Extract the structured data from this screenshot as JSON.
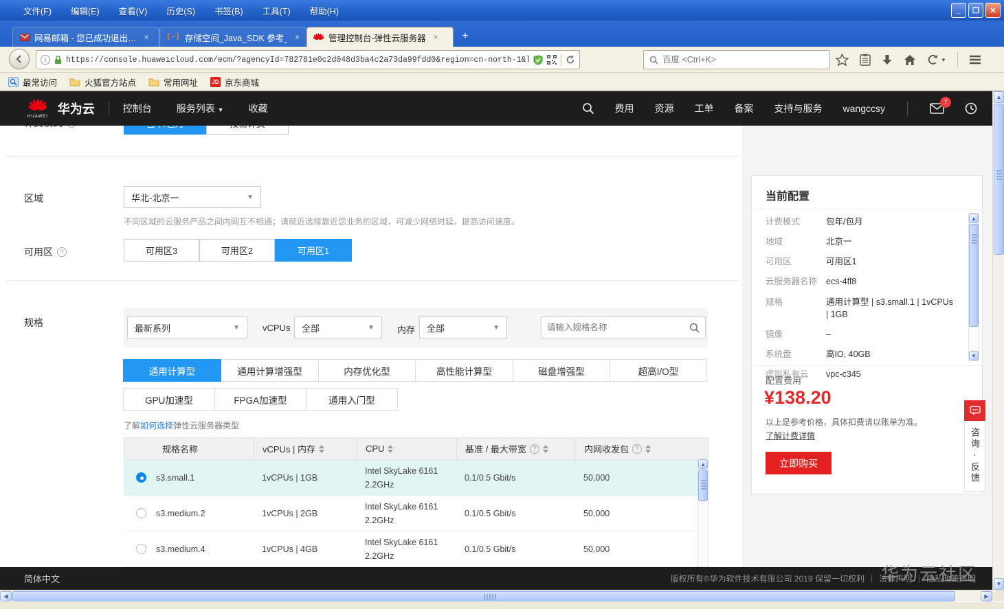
{
  "browser": {
    "menu": [
      "文件(F)",
      "编辑(E)",
      "查看(V)",
      "历史(S)",
      "书签(B)",
      "工具(T)",
      "帮助(H)"
    ],
    "window_buttons": {
      "minimize": "_",
      "restore": "❐",
      "close": "✕"
    },
    "tabs": [
      {
        "title": "网易邮箱 - 您已成功退出…",
        "close": "×"
      },
      {
        "title": "存储空间_Java_SDK 参考_…",
        "close": "×",
        "favicon_text": "(-)"
      },
      {
        "title": "管理控制台-弹性云服务器",
        "close": "×"
      }
    ],
    "new_tab": "+",
    "url": "https://console.huaweicloud.com/ecm/?agencyId=782781e0c2d048d3ba4c2a73da99fdd0&region=cn-north-1&locale=zh-cn#/ecs/create",
    "search_placeholder": "百度 <Ctrl+K>",
    "bookmarks": [
      "最常访问",
      "火狐官方站点",
      "常用网址",
      "京东商城"
    ],
    "jd_badge": "JD"
  },
  "header": {
    "brand": "华为云",
    "brand_sub": "HUAWEI",
    "nav": [
      "控制台",
      "服务列表",
      "收藏"
    ],
    "links": [
      "费用",
      "资源",
      "工单",
      "备案",
      "支持与服务"
    ],
    "username": "wangccsy",
    "mail_badge": "7"
  },
  "form": {
    "billing": {
      "label": "计费模式",
      "options": [
        "包年/包月",
        "按需计费"
      ],
      "selected": "包年/包月"
    },
    "region": {
      "label": "区域",
      "value": "华北-北京一",
      "hint": "不同区域的云服务产品之间内网互不相通；请就近选择靠近您业务的区域，可减少网络时延，提高访问速度。"
    },
    "az": {
      "label": "可用区",
      "options": [
        "可用区3",
        "可用区2",
        "可用区1"
      ],
      "selected": "可用区1"
    },
    "spec": {
      "label": "规格",
      "series_filter": "最新系列",
      "vcpus_label": "vCPUs",
      "vcpus_filter": "全部",
      "mem_label": "内存",
      "mem_filter": "全部",
      "search_placeholder": "请输入规格名称",
      "type_tabs_row1": [
        "通用计算型",
        "通用计算增强型",
        "内存优化型",
        "高性能计算型",
        "磁盘增强型",
        "超高I/O型"
      ],
      "type_tabs_row2": [
        "GPU加速型",
        "FPGA加速型",
        "通用入门型"
      ],
      "active_tab": "通用计算型",
      "help_prefix": "了解",
      "help_link": "如何选择",
      "help_suffix": "弹性云服务器类型"
    }
  },
  "spec_table": {
    "columns": [
      "规格名称",
      "vCPUs | 内存",
      "CPU",
      "基准 / 最大带宽",
      "内网收发包"
    ],
    "rows": [
      {
        "name": "s3.small.1",
        "cpu_mem": "1vCPUs | 1GB",
        "cpu": "Intel SkyLake 6161 2.2GHz",
        "bandwidth": "0.1/0.5 Gbit/s",
        "pps": "50,000",
        "selected": true
      },
      {
        "name": "s3.medium.2",
        "cpu_mem": "1vCPUs | 2GB",
        "cpu": "Intel SkyLake 6161 2.2GHz",
        "bandwidth": "0.1/0.5 Gbit/s",
        "pps": "50,000",
        "selected": false
      },
      {
        "name": "s3.medium.4",
        "cpu_mem": "1vCPUs | 4GB",
        "cpu": "Intel SkyLake 6161 2.2GHz",
        "bandwidth": "0.1/0.5 Gbit/s",
        "pps": "50,000",
        "selected": false
      }
    ]
  },
  "summary": {
    "title": "当前配置",
    "items": [
      {
        "label": "计费模式",
        "value": "包年/包月"
      },
      {
        "label": "地域",
        "value": "北京一"
      },
      {
        "label": "可用区",
        "value": "可用区1"
      },
      {
        "label": "云服务器名称",
        "value": "ecs-4ff8"
      },
      {
        "label": "规格",
        "value": "通用计算型 | s3.small.1 | 1vCPUs | 1GB"
      },
      {
        "label": "镜像",
        "value": "–"
      },
      {
        "label": "系统盘",
        "value": "高IO, 40GB"
      },
      {
        "label": "虚拟私有云",
        "value": "vpc-c345"
      }
    ],
    "price_label": "配置费用",
    "price": "¥138.20",
    "price_note": "以上是参考价格，具体扣费请以账单为准。",
    "price_link": "了解计费详情",
    "buy_button": "立即购买"
  },
  "feedback": {
    "label": "咨询·反馈"
  },
  "footer": {
    "language": "简体中文",
    "copyright": "版权所有©华为软件技术有限公司 2019 保留一切权利",
    "links": [
      "法律声明",
      "隐私政策声明"
    ],
    "watermark": "华为云社区"
  },
  "icons": {
    "search": "magnifier",
    "help": "question-circle",
    "sort": "sort-arrows",
    "mail": "envelope",
    "time": "clock",
    "feedback": "chat-bubble",
    "lock": "padlock",
    "security": "shield-check",
    "qr": "qr-code"
  },
  "colors": {
    "accent": "#2196f3",
    "danger": "#e22b2b",
    "selected_row": "#e1f6f4",
    "titlebar": "#2565cd"
  }
}
